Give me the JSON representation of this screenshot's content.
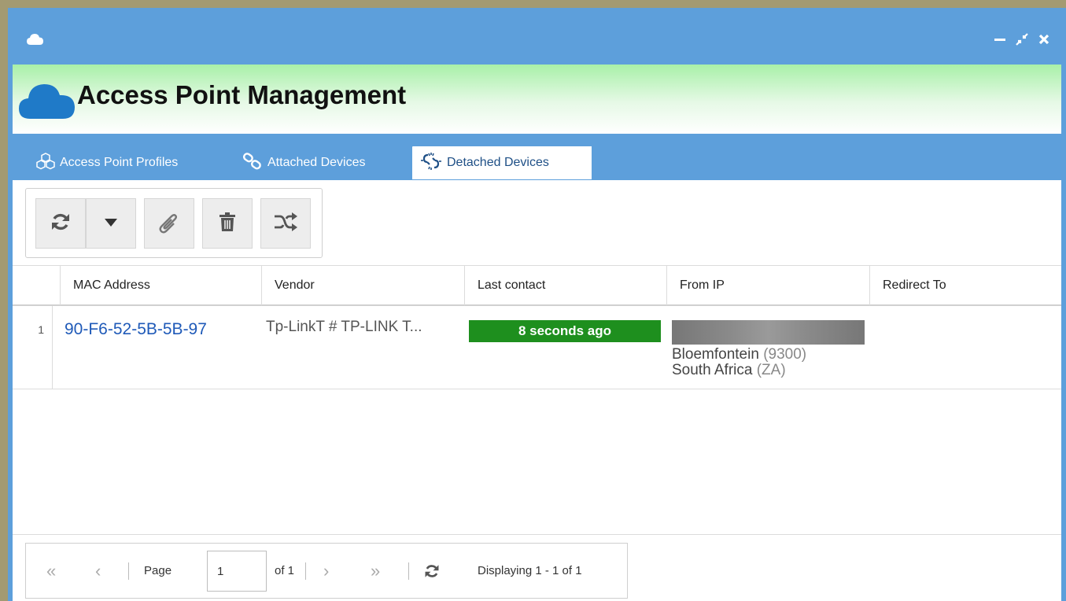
{
  "window": {
    "controls": [
      "minimize-icon",
      "restore-icon",
      "close-icon"
    ]
  },
  "header": {
    "title": "Access Point Management"
  },
  "tabs": [
    {
      "label": "Access Point Profiles",
      "icon": "cubes-icon",
      "active": false
    },
    {
      "label": "Attached Devices",
      "icon": "link-icon",
      "active": false
    },
    {
      "label": "Detached Devices",
      "icon": "unlink-icon",
      "active": true
    }
  ],
  "toolbar": {
    "buttons": [
      "refresh-icon",
      "caret-down-icon",
      "paperclip-icon",
      "trash-icon",
      "shuffle-icon"
    ]
  },
  "grid": {
    "columns": [
      "MAC Address",
      "Vendor",
      "Last contact",
      "From IP",
      "Redirect To"
    ],
    "rows": [
      {
        "num": "1",
        "mac": "90-F6-52-5B-5B-97",
        "vendor": "Tp-LinkT # TP-LINK T...",
        "last_contact": "8 seconds ago",
        "city": "Bloemfontein",
        "postal": "(9300)",
        "country": "South Africa",
        "country_code": "(ZA)",
        "redirect": ""
      }
    ]
  },
  "pager": {
    "page_label": "Page",
    "page_value": "1",
    "of_label": "of 1",
    "display_text": "Displaying 1 - 1 of 1"
  },
  "colors": {
    "titlebar": "#5d9fdb",
    "contact_badge": "#1e8f1e",
    "link": "#1f5ab8"
  }
}
